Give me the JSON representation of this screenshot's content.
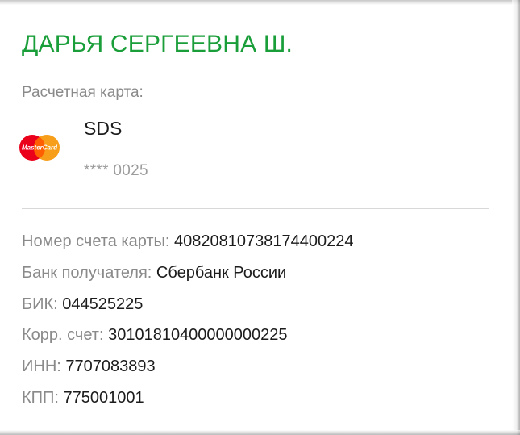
{
  "recipient": {
    "name": "ДАРЬЯ СЕРГЕЕВНА Ш."
  },
  "card": {
    "section_label": "Расчетная карта:",
    "logo_icon": "mastercard-logo-icon",
    "logo_text": "MasterCard",
    "name": "SDS",
    "masked_number": "**** 0025"
  },
  "details": [
    {
      "label": "Номер счета карты:",
      "value": "40820810738174400224"
    },
    {
      "label": "Банк получателя:",
      "value": "Сбербанк России"
    },
    {
      "label": "БИК:",
      "value": "044525225"
    },
    {
      "label": "Корр. счет:",
      "value": "30101810400000000225"
    },
    {
      "label": "ИНН:",
      "value": "7707083893"
    },
    {
      "label": "КПП:",
      "value": "775001001"
    }
  ],
  "colors": {
    "name_green": "#1a9e3a",
    "label_gray": "#8a8a8a",
    "mastercard_red": "#eb001b",
    "mastercard_orange": "#f79e1b"
  }
}
